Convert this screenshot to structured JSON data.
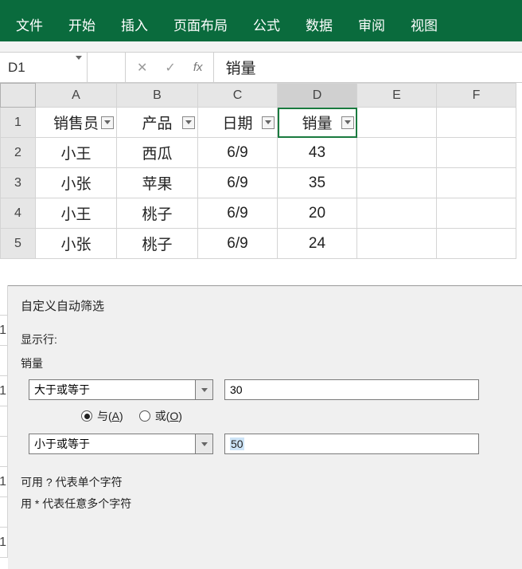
{
  "ribbon": {
    "tabs": [
      "文件",
      "开始",
      "插入",
      "页面布局",
      "公式",
      "数据",
      "审阅",
      "视图"
    ]
  },
  "formula_bar": {
    "name_box": "D1",
    "value": "销量"
  },
  "sheet": {
    "columns": [
      "A",
      "B",
      "C",
      "D",
      "E",
      "F"
    ],
    "row_numbers": [
      "1",
      "2",
      "3",
      "4",
      "5"
    ],
    "headers": {
      "A": "销售员",
      "B": "产品",
      "C": "日期",
      "D": "销量"
    },
    "rows": [
      {
        "A": "小王",
        "B": "西瓜",
        "C": "6/9",
        "D": "43"
      },
      {
        "A": "小张",
        "B": "苹果",
        "C": "6/9",
        "D": "35"
      },
      {
        "A": "小王",
        "B": "桃子",
        "C": "6/9",
        "D": "20"
      },
      {
        "A": "小张",
        "B": "桃子",
        "C": "6/9",
        "D": "24"
      }
    ],
    "selected_cell": "D1"
  },
  "dialog": {
    "title": "自定义自动筛选",
    "show_rows_label": "显示行:",
    "field": "销量",
    "cond1_op": "大于或等于",
    "cond1_val": "30",
    "cond2_op": "小于或等于",
    "cond2_val": "50",
    "and_label_prefix": "与(",
    "and_label_key": "A",
    "and_label_suffix": ")",
    "or_label_prefix": "或(",
    "or_label_key": "O",
    "or_label_suffix": ")",
    "logic_selected": "and",
    "hint1": "可用 ? 代表单个字符",
    "hint2": "用 * 代表任意多个字符"
  },
  "peek_rows": [
    "",
    "1",
    "",
    "1",
    "",
    "",
    "1",
    "",
    "1"
  ]
}
